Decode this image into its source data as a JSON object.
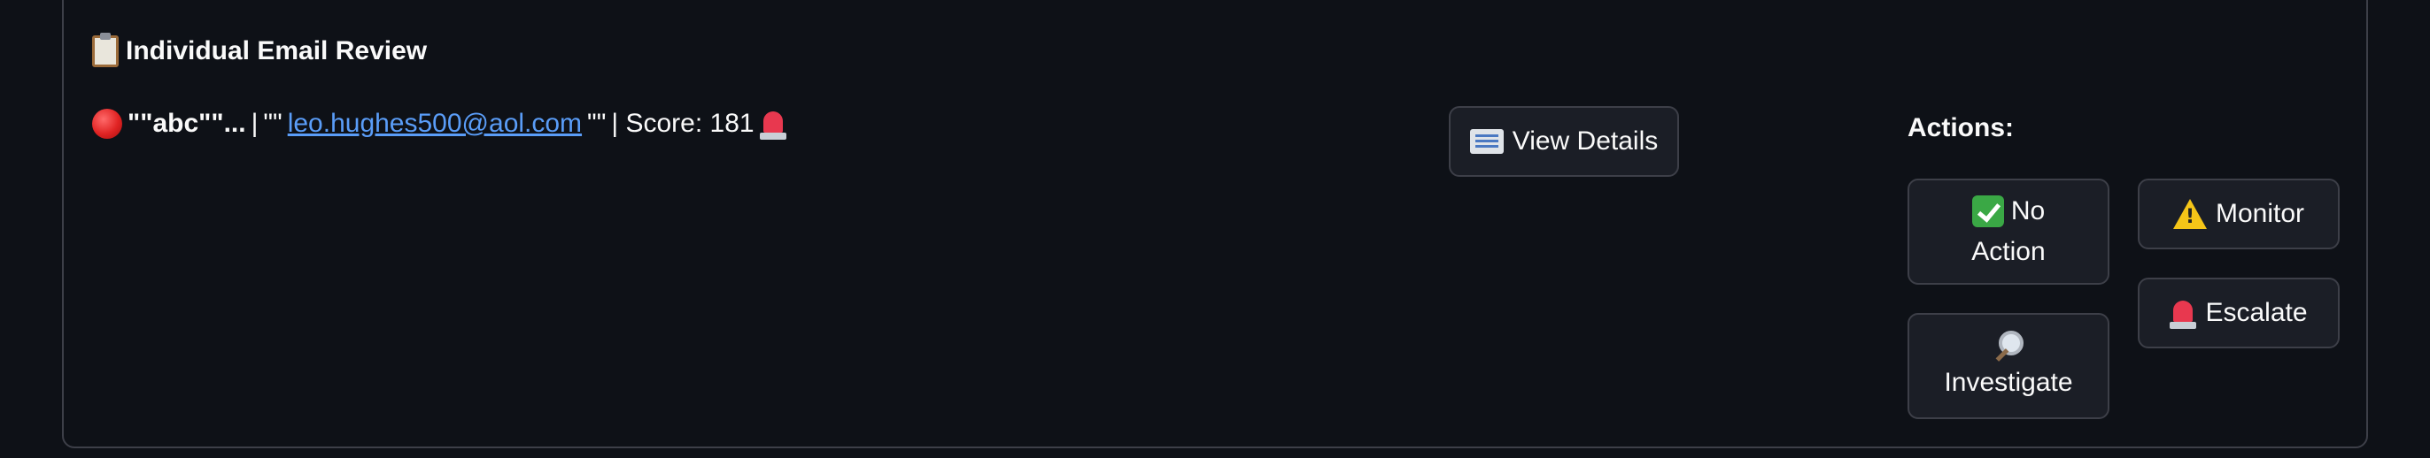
{
  "section": {
    "icon": "clipboard-icon",
    "title": "Individual Email Review"
  },
  "email": {
    "status_icon": "red-circle-icon",
    "subject": "\"\"abc\"\"...",
    "separator": "|",
    "sender_prefix": "\"\"",
    "sender_email": "leo.hughes500@aol.com",
    "sender_suffix": "\"\"",
    "score_text": "| Score: 181",
    "alert_icon": "siren-icon"
  },
  "buttons": {
    "view_details": "View Details"
  },
  "actions": {
    "label": "Actions:",
    "no_action_line1": "No",
    "no_action_line2": "Action",
    "monitor": "Monitor",
    "escalate": "Escalate",
    "investigate": "Investigate"
  },
  "colors": {
    "background": "#0e1117",
    "border": "#3d3f48",
    "link": "#5a9df8",
    "button_bg": "#1b1e26"
  }
}
